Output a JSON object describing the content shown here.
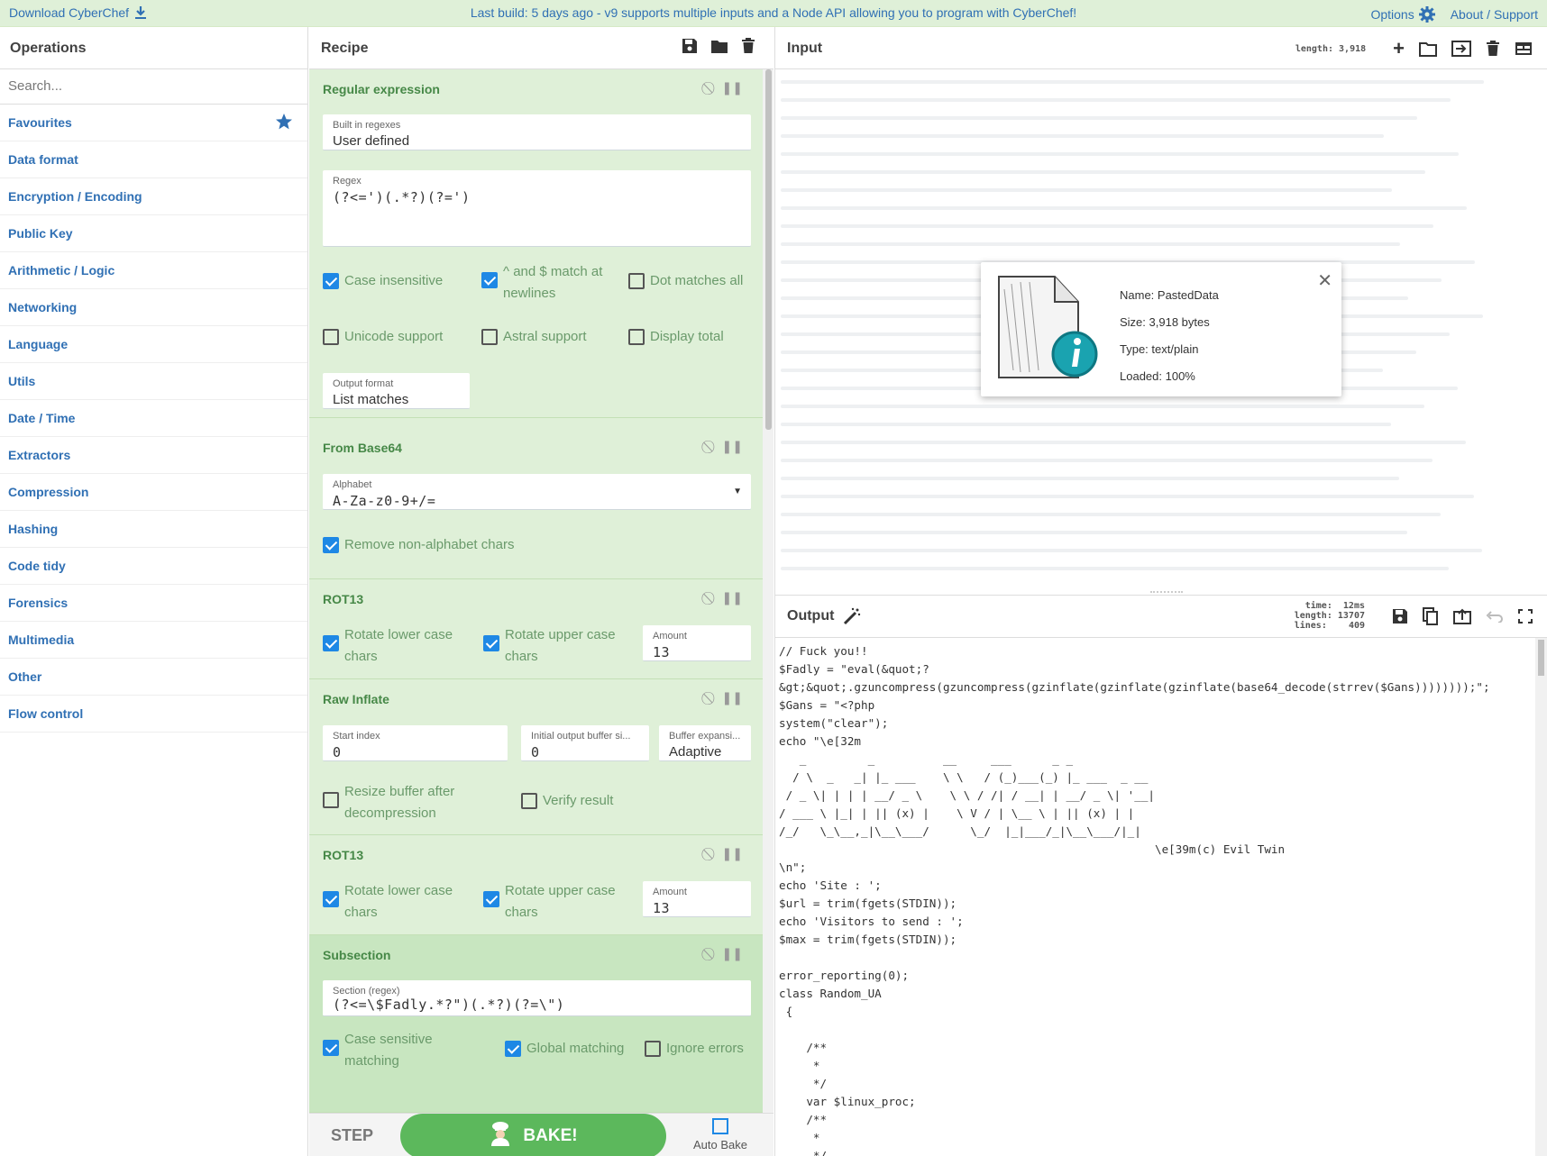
{
  "banner": {
    "download": "Download CyberChef",
    "message": "Last build: 5 days ago - v9 supports multiple inputs and a Node API allowing you to program with CyberChef!",
    "options": "Options",
    "about": "About / Support"
  },
  "operations": {
    "title": "Operations",
    "search_placeholder": "Search...",
    "categories": [
      "Favourites",
      "Data format",
      "Encryption / Encoding",
      "Public Key",
      "Arithmetic / Logic",
      "Networking",
      "Language",
      "Utils",
      "Date / Time",
      "Extractors",
      "Compression",
      "Hashing",
      "Code tidy",
      "Forensics",
      "Multimedia",
      "Other",
      "Flow control"
    ]
  },
  "recipe": {
    "title": "Recipe",
    "ops": {
      "regex": {
        "name": "Regular expression",
        "builtin_label": "Built in regexes",
        "builtin_value": "User defined",
        "regex_label": "Regex",
        "regex_value": "(?<=')(.*?)(?=')",
        "case_insensitive": "Case insensitive",
        "multiline": "^ and $ match at newlines",
        "dotall": "Dot matches all",
        "unicode": "Unicode support",
        "astral": "Astral support",
        "display_total": "Display total",
        "output_format_label": "Output format",
        "output_format_value": "List matches"
      },
      "base64": {
        "name": "From Base64",
        "alphabet_label": "Alphabet",
        "alphabet_value": "A-Za-z0-9+/=",
        "remove_nonalpha": "Remove non-alphabet chars"
      },
      "rot13a": {
        "name": "ROT13",
        "lower": "Rotate lower case chars",
        "upper": "Rotate upper case chars",
        "amount_label": "Amount",
        "amount_value": "13"
      },
      "inflate": {
        "name": "Raw Inflate",
        "start_label": "Start index",
        "start_value": "0",
        "initbuf_label": "Initial output buffer si...",
        "initbuf_value": "0",
        "bufexp_label": "Buffer expansi...",
        "bufexp_value": "Adaptive",
        "resize": "Resize buffer after decompression",
        "verify": "Verify result"
      },
      "rot13b": {
        "name": "ROT13",
        "lower": "Rotate lower case chars",
        "upper": "Rotate upper case chars",
        "amount_label": "Amount",
        "amount_value": "13"
      },
      "subsection": {
        "name": "Subsection",
        "section_label": "Section (regex)",
        "section_value": "(?<=\\$Fadly.*?\")(.*?)(?=\\\")",
        "case_sensitive": "Case sensitive matching",
        "global": "Global matching",
        "ignore_errors": "Ignore errors"
      }
    },
    "step": "STEP",
    "bake": "BAKE!",
    "auto_bake": "Auto Bake"
  },
  "input": {
    "title": "Input",
    "length_label": "length:",
    "length_value": "3,918"
  },
  "fileinfo": {
    "name": "Name: PastedData",
    "size": "Size: 3,918 bytes",
    "type": "Type: text/plain",
    "loaded": "Loaded: 100%"
  },
  "output": {
    "title": "Output",
    "time_label": "time:",
    "time_value": "12ms",
    "length_label": "length:",
    "length_value": "13707",
    "lines_label": "lines:",
    "lines_value": "409",
    "lines": [
      "// Fuck you!!",
      "$Fadly = \"eval(&quot;?",
      "&gt;&quot;.gzuncompress(gzuncompress(gzinflate(gzinflate(gzinflate(base64_decode(strrev($Gans))))))));\";",
      "$Gans = \"<?php",
      "system(\"clear\");",
      "echo \"\\e[32m",
      "   _         _          __     ___      _ _",
      "  / \\  _   _| |_ ___    \\ \\   / (_)___(_) |_ ___  _ __",
      " / _ \\| | | | __/ _ \\    \\ \\ / /| / __| | __/ _ \\| '__|",
      "/ ___ \\ |_| | || (x) |    \\ V / | \\__ \\ | || (x) | |",
      "/_/   \\_\\__,_|\\__\\___/      \\_/  |_|___/_|\\__\\___/|_|",
      "                                                       \\e[39m(c) Evil Twin",
      "\\n\";",
      "echo 'Site : ';",
      "$url = trim(fgets(STDIN));",
      "echo 'Visitors to send : ';",
      "$max = trim(fgets(STDIN));",
      "",
      "error_reporting(0);",
      "class Random_UA",
      " {",
      "",
      "    /**",
      "     *",
      "     */",
      "    var $linux_proc;",
      "    /**",
      "     *",
      "     */"
    ]
  },
  "colors": {
    "accent": "#3070b4",
    "recipe_bg": "#dff0d8",
    "op_name": "#468847",
    "bake": "#5cb85c",
    "checkbox": "#1e88e5"
  }
}
